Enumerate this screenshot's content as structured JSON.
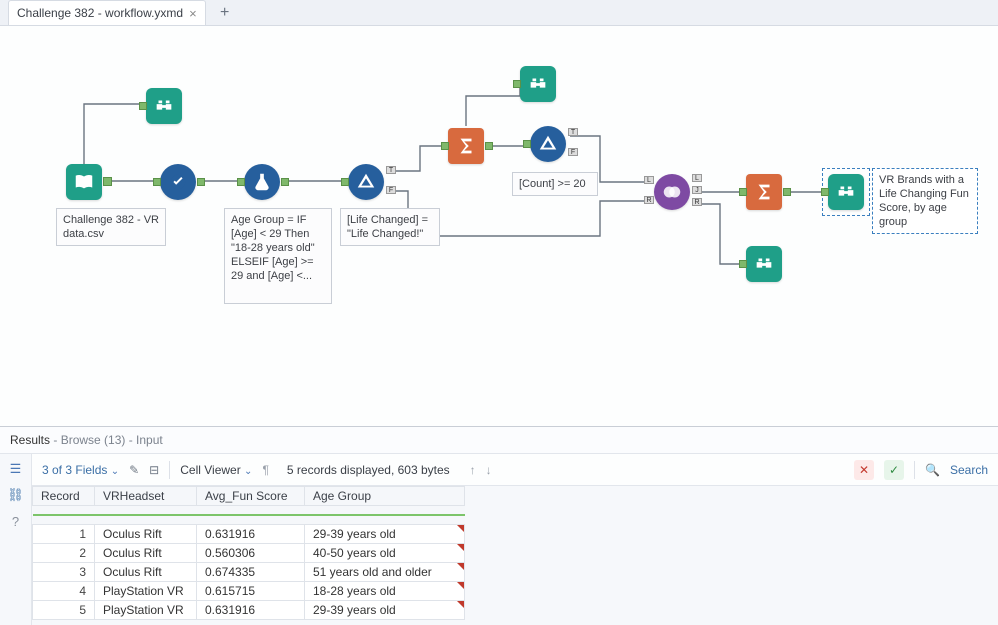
{
  "tab": {
    "title": "Challenge 382 - workflow.yxmd"
  },
  "annotations": {
    "input": "Challenge 382 - VR data.csv",
    "formula": "Age Group = IF [Age] < 29 Then \"18-28 years old\" ELSEIF [Age] >= 29 and [Age] <...",
    "filter1": "[Life Changed] = \"Life Changed!\"",
    "filter2": "[Count] >= 20",
    "output": "VR Brands with a Life Changing Fun Score, by age group"
  },
  "results": {
    "title": "Results",
    "subtitle": "- Browse (13) - Input",
    "fields_label": "3 of 3 Fields",
    "cell_viewer_label": "Cell Viewer",
    "status": "5 records displayed, 603 bytes",
    "search_label": "Search",
    "columns": [
      "Record",
      "VRHeadset",
      "Avg_Fun Score",
      "Age Group"
    ],
    "rows": [
      {
        "n": "1",
        "headset": "Oculus Rift",
        "score": "0.631916",
        "group": "29-39 years old"
      },
      {
        "n": "2",
        "headset": "Oculus Rift",
        "score": "0.560306",
        "group": "40-50 years old"
      },
      {
        "n": "3",
        "headset": "Oculus Rift",
        "score": "0.674335",
        "group": "51 years old and older"
      },
      {
        "n": "4",
        "headset": "PlayStation VR",
        "score": "0.615715",
        "group": "18-28 years old"
      },
      {
        "n": "5",
        "headset": "PlayStation VR",
        "score": "0.631916",
        "group": "29-39 years old"
      }
    ]
  }
}
